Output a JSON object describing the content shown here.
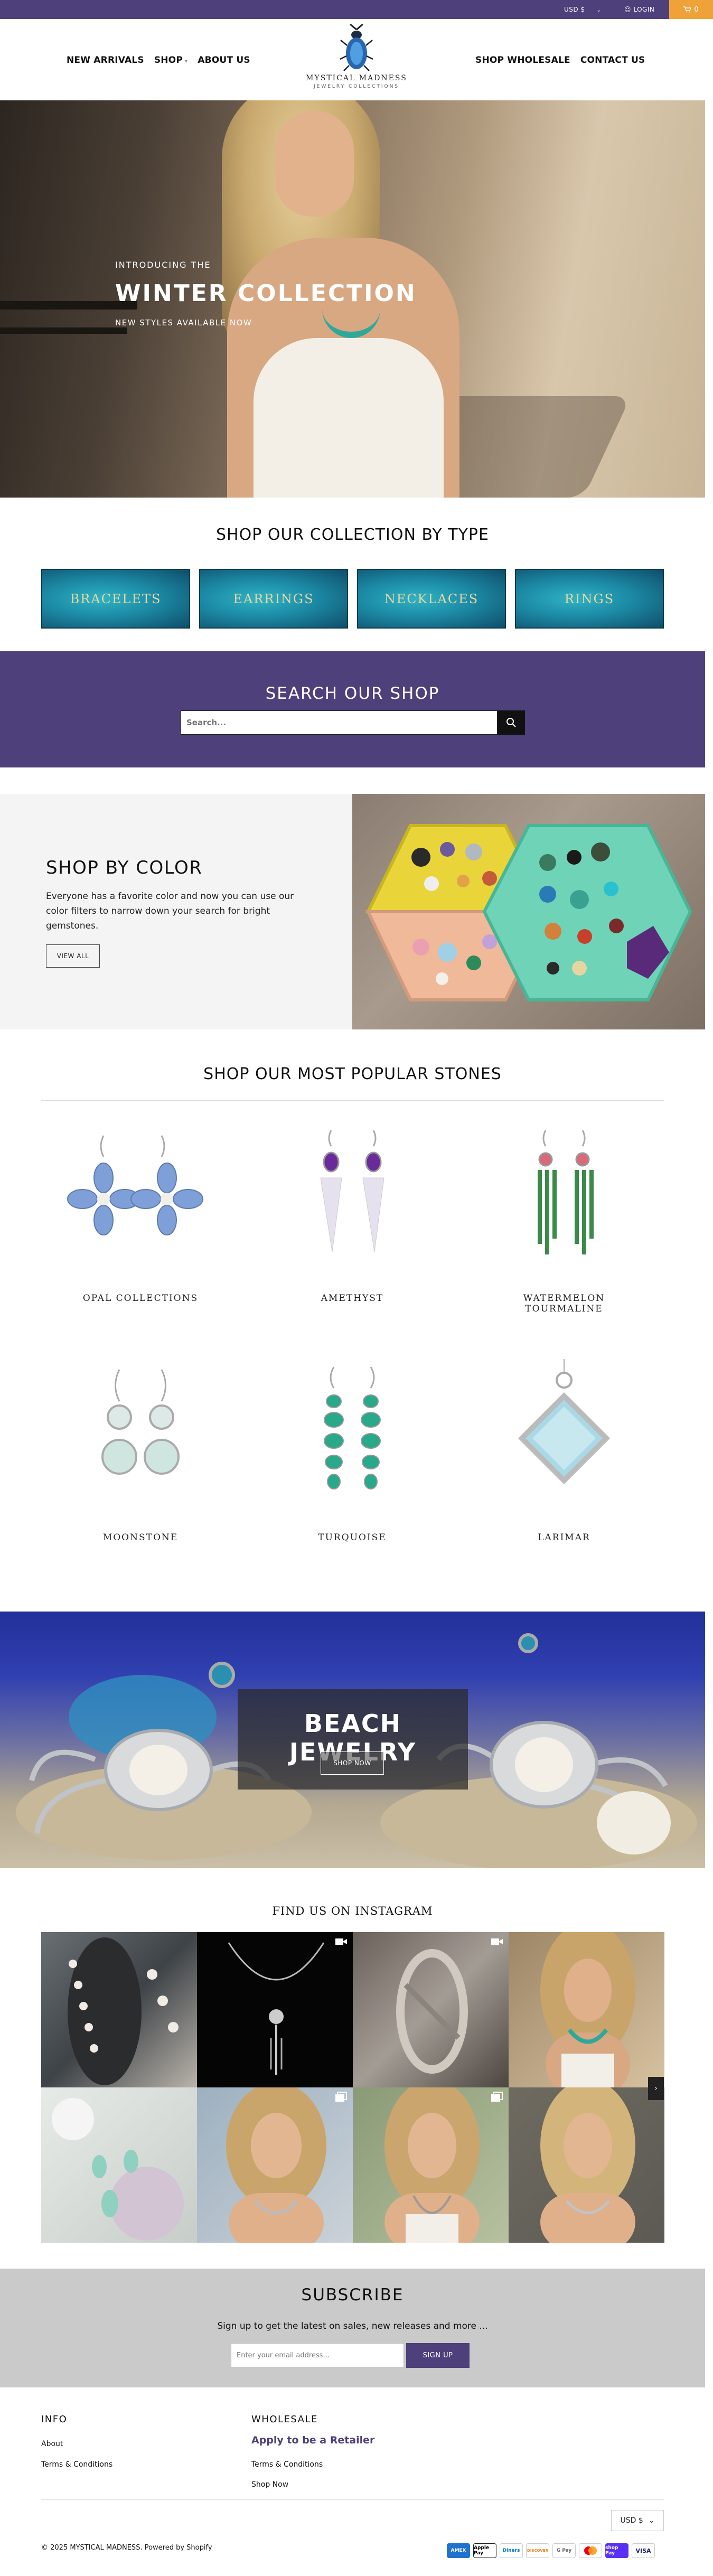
{
  "topbar": {
    "currency": "USD $",
    "login": "LOGIN",
    "cart_count": "0",
    "colors": {
      "bar": "#4e407a",
      "cart": "#f0a23a"
    }
  },
  "header": {
    "nav_left": [
      "NEW ARRIVALS",
      "SHOP",
      "ABOUT US"
    ],
    "nav_right": [
      "SHOP WHOLESALE",
      "CONTACT US"
    ],
    "logo": {
      "brand": "MYSTICAL MADNESS",
      "sub": "JEWELRY COLLECTIONS"
    }
  },
  "hero": {
    "intro": "INTRODUCING THE",
    "title": "WINTER COLLECTION",
    "subtitle": "NEW STYLES AVAILABLE NOW"
  },
  "collection": {
    "title": "SHOP OUR COLLECTION BY TYPE",
    "types": [
      "BRACELETS",
      "EARRINGS",
      "NECKLACES",
      "RINGS"
    ]
  },
  "search": {
    "title": "SEARCH OUR SHOP",
    "placeholder": "Search...",
    "icon": "search-icon"
  },
  "shop_by_color": {
    "title": "SHOP BY COLOR",
    "text": "Everyone has a favorite color and now you can use our color filters to narrow down your search for bright gemstones.",
    "button": "VIEW ALL"
  },
  "stones": {
    "title": "SHOP OUR MOST POPULAR STONES",
    "items": [
      "OPAL COLLECTIONS",
      "AMETHYST",
      "WATERMELON TOURMALINE",
      "MOONSTONE",
      "TURQUOISE",
      "LARIMAR"
    ]
  },
  "beach": {
    "title": "BEACH JEWELRY",
    "button": "SHOP NOW"
  },
  "instagram": {
    "title": "FIND US ON INSTAGRAM"
  },
  "subscribe": {
    "title": "SUBSCRIBE",
    "text": "Sign up to get the latest on sales, new releases and more ...",
    "placeholder": "Enter your email address...",
    "button": "SIGN UP"
  },
  "footer": {
    "info_title": "INFO",
    "info_links": [
      "About",
      "Terms & Conditions"
    ],
    "wholesale_title": "WHOLESALE",
    "retailer": "Apply to be a Retailer",
    "wholesale_links": [
      "Terms & Conditions",
      "Shop Now"
    ],
    "currency": "USD $",
    "copyright": "© 2025 MYSTICAL MADNESS. Powered by Shopify",
    "payments": [
      "AMEX",
      "Apple Pay",
      "Diners",
      "DISCOVER",
      "G Pay",
      "Mastercard",
      "shop Pay",
      "VISA"
    ]
  }
}
